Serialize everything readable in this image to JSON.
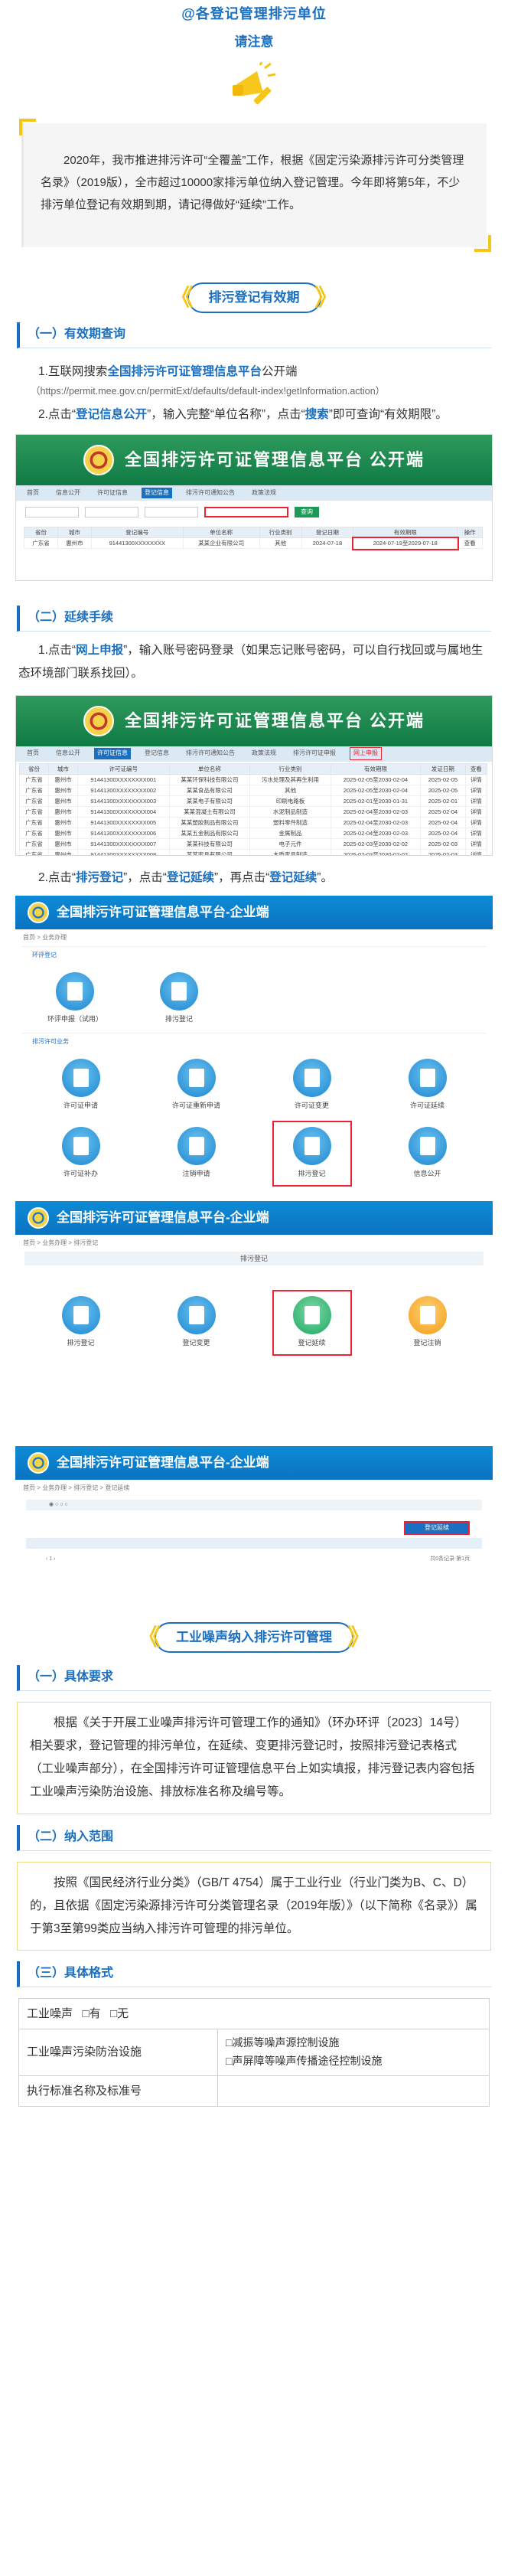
{
  "header": {
    "title": "@各登记管理排污单位",
    "subtitle": "请注意",
    "intro": "2020年，我市推进排污许可“全覆盖”工作，根据《固定污染源排污许可分类管理名录》（2019版），全市超过10000家排污单位纳入登记管理。今年即将第5年，不少排污单位登记有效期到期，请记得做好“延续”工作。"
  },
  "section1": {
    "title": "排污登记有效期",
    "sub1": {
      "title": "（一）有效期查询",
      "step1_prefix": "1.互联网搜索",
      "step1_link": "全国排污许可证管理信息平台",
      "step1_suffix": "公开端",
      "url": "（https://permit.mee.gov.cn/permitExt/defaults/default-index!getInformation.action）",
      "step2_a": "2.点击“",
      "step2_b": "登记信息公开",
      "step2_c": "”，输入完整“单位名称”，点击“",
      "step2_d": "搜索",
      "step2_e": "”即可查询“有效期限”。"
    },
    "sub2": {
      "title": "（二）延续手续",
      "step1_a": "1.点击“",
      "step1_b": "网上申报",
      "step1_c": "”，输入账号密码登录（如果忘记账号密码，可以自行找回或与属地生态环境部门联系找回）。",
      "step2_a": "2.点击“",
      "step2_b": "排污登记",
      "step2_c": "”，点击“",
      "step2_d": "登记延续",
      "step2_e": "”，再点击“",
      "step2_f": "登记延续",
      "step2_g": "”。"
    }
  },
  "public_portal": {
    "title": "全国排污许可证管理信息平台  公开端",
    "nav": [
      "首页",
      "信息公开",
      "许可证信息",
      "登记信息",
      "排污许可通知公告",
      "政策法规",
      "排污许可证申报",
      "网上申报"
    ],
    "search_button": "查询"
  },
  "query_table": {
    "headers": [
      "省份",
      "城市",
      "登记编号",
      "单位名称",
      "行业类别",
      "登记日期",
      "有效期限",
      "操作"
    ],
    "row": [
      "广东省",
      "惠州市",
      "91441300XXXXXXXX",
      "某某企业有限公司",
      "其他",
      "2024-07-18",
      "2024-07-19至2029-07-18",
      "查看"
    ]
  },
  "list_table": {
    "headers": [
      "省份",
      "城市",
      "许可证编号",
      "单位名称",
      "行业类别",
      "有效期限",
      "发证日期",
      "查看"
    ],
    "rows": [
      [
        "广东省",
        "惠州市",
        "91441300XXXXXXXX001",
        "某某环保科技有限公司",
        "污水处理及其再生利用",
        "2025-02-05至2030-02-04",
        "2025-02-05",
        "详情"
      ],
      [
        "广东省",
        "惠州市",
        "91441300XXXXXXXX002",
        "某某食品有限公司",
        "其他",
        "2025-02-05至2030-02-04",
        "2025-02-05",
        "详情"
      ],
      [
        "广东省",
        "惠州市",
        "91441300XXXXXXXX003",
        "某某电子有限公司",
        "印刷电路板",
        "2025-02-01至2030-01-31",
        "2025-02-01",
        "详情"
      ],
      [
        "广东省",
        "惠州市",
        "91441300XXXXXXXX004",
        "某某混凝土有限公司",
        "水泥制品制造",
        "2025-02-04至2030-02-03",
        "2025-02-04",
        "详情"
      ],
      [
        "广东省",
        "惠州市",
        "91441300XXXXXXXX005",
        "某某塑胶制品有限公司",
        "塑料零件制造",
        "2025-02-04至2030-02-03",
        "2025-02-04",
        "详情"
      ],
      [
        "广东省",
        "惠州市",
        "91441300XXXXXXXX006",
        "某某五金制品有限公司",
        "金属制品",
        "2025-02-04至2030-02-03",
        "2025-02-04",
        "详情"
      ],
      [
        "广东省",
        "惠州市",
        "91441300XXXXXXXX007",
        "某某科技有限公司",
        "电子元件",
        "2025-02-03至2030-02-02",
        "2025-02-03",
        "详情"
      ],
      [
        "广东省",
        "惠州市",
        "91441300XXXXXXXX008",
        "某某家具有限公司",
        "木质家具制造",
        "2025-02-03至2030-02-02",
        "2025-02-03",
        "详情"
      ]
    ]
  },
  "enterprise_portal": {
    "title": "全国排污许可证管理信息平台-企业端",
    "crumb": "首页 > 业务办理",
    "group1": "环评登记",
    "group1_tiles": [
      "环评申报（试用）",
      "排污登记"
    ],
    "group2": "排污许可业务",
    "group2_tiles_r1": [
      "许可证申请",
      "许可证重新申请",
      "许可证变更",
      "许可证延续"
    ],
    "group2_tiles_r2": [
      "许可证补办",
      "注销申请",
      "排污登记",
      "信息公开"
    ],
    "crumb2": "首页 > 业务办理 > 排污登记",
    "panel_title": "排污登记",
    "reg_tiles": [
      "排污登记",
      "登记变更",
      "登记延续",
      "登记注销"
    ],
    "crumb3": "首页 > 业务办理 > 排污登记 > 登记延续",
    "reg_button": "登记延续",
    "pager": "共0条记录 第1页"
  },
  "section2": {
    "title": "工业噪声纳入排污许可管理",
    "sub1_title": "（一）具体要求",
    "sub1_text": "根据《关于开展工业噪声排污许可管理工作的通知》（环办环评〔2023〕14号）相关要求，登记管理的排污单位，在延续、变更排污登记时，按照排污登记表格式（工业噪声部分），在全国排污许可证管理信息平台上如实填报，排污登记表内容包括工业噪声污染防治设施、排放标准名称及编号等。",
    "sub2_title": "（二）纳入范围",
    "sub2_text": "按照《国民经济行业分类》（GB/T 4754）属于工业行业（行业门类为B、C、D）的，且依据《固定污染源排污许可分类管理名录（2019年版）》（以下简称《名录》）属于第3至第99类应当纳入排污许可管理的排污单位。",
    "sub3_title": "（三）具体格式",
    "form": {
      "row1_label": "工业噪声",
      "row1_opt1": "□有",
      "row1_opt2": "□无",
      "row2_label": "工业噪声污染防治设施",
      "row2_opt1": "□减振等噪声源控制设施",
      "row2_opt2": "□声屏障等噪声传播途径控制设施",
      "row3_label": "执行标准名称及标准号",
      "row3_value": ""
    }
  },
  "colors": {
    "brand_blue": "#1a6fc0",
    "accent_yellow": "#f5c518",
    "highlight_red": "#e22233",
    "portal_green": "#0f7a44"
  }
}
